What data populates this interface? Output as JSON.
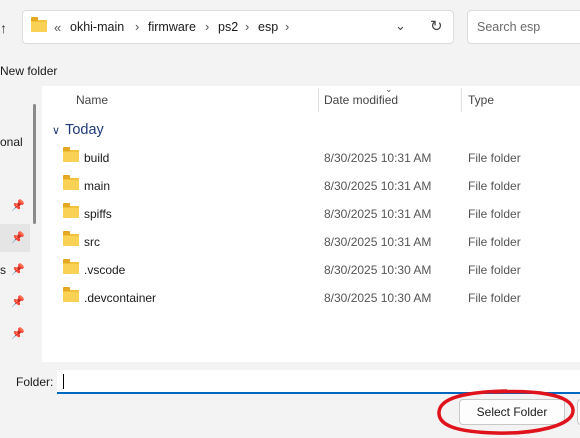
{
  "toolbar": {
    "breadcrumb": [
      "okhi-main",
      "firmware",
      "ps2",
      "esp"
    ],
    "overflow_chevron": "«",
    "separator": "›",
    "search_placeholder": "Search esp",
    "new_folder_label": "New folder"
  },
  "navigation": {
    "partial_labels": [
      "onal",
      "s"
    ]
  },
  "columns": {
    "name": "Name",
    "date_modified": "Date modified",
    "type": "Type"
  },
  "group": {
    "label": "Today"
  },
  "files": [
    {
      "name": "build",
      "date": "8/30/2025 10:31 AM",
      "type": "File folder"
    },
    {
      "name": "main",
      "date": "8/30/2025 10:31 AM",
      "type": "File folder"
    },
    {
      "name": "spiffs",
      "date": "8/30/2025 10:31 AM",
      "type": "File folder"
    },
    {
      "name": "src",
      "date": "8/30/2025 10:31 AM",
      "type": "File folder"
    },
    {
      "name": ".vscode",
      "date": "8/30/2025 10:30 AM",
      "type": "File folder"
    },
    {
      "name": ".devcontainer",
      "date": "8/30/2025 10:30 AM",
      "type": "File folder"
    }
  ],
  "footer": {
    "folder_label": "Folder:",
    "folder_value": "",
    "select_button": "Select Folder"
  },
  "colors": {
    "accent": "#0067c0",
    "folder": "#f8d155",
    "annotation": "#e0121b"
  }
}
